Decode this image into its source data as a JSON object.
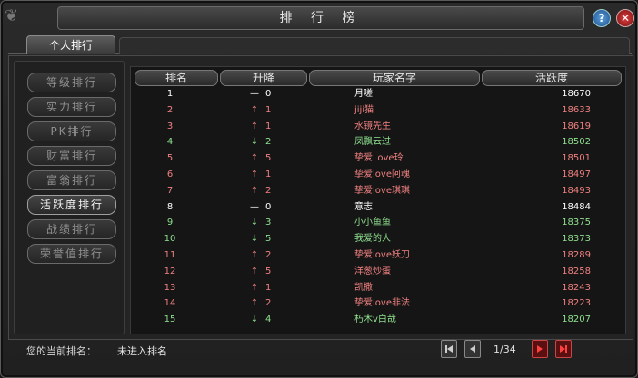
{
  "window": {
    "title": "排 行 榜",
    "help_label": "?",
    "close_label": "✕"
  },
  "tabs": [
    {
      "label": "个人排行",
      "active": true
    }
  ],
  "sidebar": {
    "items": [
      {
        "label": "等级排行",
        "active": false
      },
      {
        "label": "实力排行",
        "active": false
      },
      {
        "label": "PK排行",
        "active": false
      },
      {
        "label": "财富排行",
        "active": false
      },
      {
        "label": "富翁排行",
        "active": false
      },
      {
        "label": "活跃度排行",
        "active": true
      },
      {
        "label": "战绩排行",
        "active": false
      },
      {
        "label": "荣誉值排行",
        "active": false
      }
    ]
  },
  "table": {
    "headers": [
      "排名",
      "升降",
      "玩家名字",
      "活跃度"
    ],
    "rows": [
      {
        "rank": "1",
        "trend": "none",
        "trend_symbol": "—",
        "change": "0",
        "name": "月嗟",
        "activity": "18670",
        "color": "#ffffff"
      },
      {
        "rank": "2",
        "trend": "up",
        "trend_symbol": "↑",
        "change": "1",
        "name": "jiji猫",
        "activity": "18633",
        "color": "#f08080"
      },
      {
        "rank": "3",
        "trend": "up",
        "trend_symbol": "↑",
        "change": "1",
        "name": "水镜先生",
        "activity": "18619",
        "color": "#f08080"
      },
      {
        "rank": "4",
        "trend": "down",
        "trend_symbol": "↓",
        "change": "2",
        "name": "凤飘云过",
        "activity": "18502",
        "color": "#8fe08f"
      },
      {
        "rank": "5",
        "trend": "up",
        "trend_symbol": "↑",
        "change": "5",
        "name": "挚爱Love玲",
        "activity": "18501",
        "color": "#f08080"
      },
      {
        "rank": "6",
        "trend": "up",
        "trend_symbol": "↑",
        "change": "1",
        "name": "挚爱love阿魂",
        "activity": "18497",
        "color": "#f08080"
      },
      {
        "rank": "7",
        "trend": "up",
        "trend_symbol": "↑",
        "change": "2",
        "name": "挚爱love琪琪",
        "activity": "18493",
        "color": "#f08080"
      },
      {
        "rank": "8",
        "trend": "none",
        "trend_symbol": "—",
        "change": "0",
        "name": "意志",
        "activity": "18484",
        "color": "#ffffff"
      },
      {
        "rank": "9",
        "trend": "down",
        "trend_symbol": "↓",
        "change": "3",
        "name": "小小鱼鱼",
        "activity": "18375",
        "color": "#8fe08f"
      },
      {
        "rank": "10",
        "trend": "down",
        "trend_symbol": "↓",
        "change": "5",
        "name": "我爱的人",
        "activity": "18373",
        "color": "#8fe08f"
      },
      {
        "rank": "11",
        "trend": "up",
        "trend_symbol": "↑",
        "change": "2",
        "name": "挚爱love妖刀",
        "activity": "18289",
        "color": "#f08080"
      },
      {
        "rank": "12",
        "trend": "up",
        "trend_symbol": "↑",
        "change": "5",
        "name": "洋葱炒蛋",
        "activity": "18258",
        "color": "#f08080"
      },
      {
        "rank": "13",
        "trend": "up",
        "trend_symbol": "↑",
        "change": "1",
        "name": "凯撒",
        "activity": "18243",
        "color": "#f08080"
      },
      {
        "rank": "14",
        "trend": "up",
        "trend_symbol": "↑",
        "change": "2",
        "name": "挚爱love非法",
        "activity": "18223",
        "color": "#f08080"
      },
      {
        "rank": "15",
        "trend": "down",
        "trend_symbol": "↓",
        "change": "4",
        "name": "朽木v白哉",
        "activity": "18207",
        "color": "#8fe08f"
      }
    ]
  },
  "status": {
    "current_rank_label": "您的当前排名：",
    "current_rank_value": "未进入排名",
    "page": "1/34"
  },
  "icons": {
    "first_page": "first-page-icon",
    "prev_page": "prev-page-icon",
    "next_page": "next-page-icon",
    "last_page": "last-page-icon"
  }
}
